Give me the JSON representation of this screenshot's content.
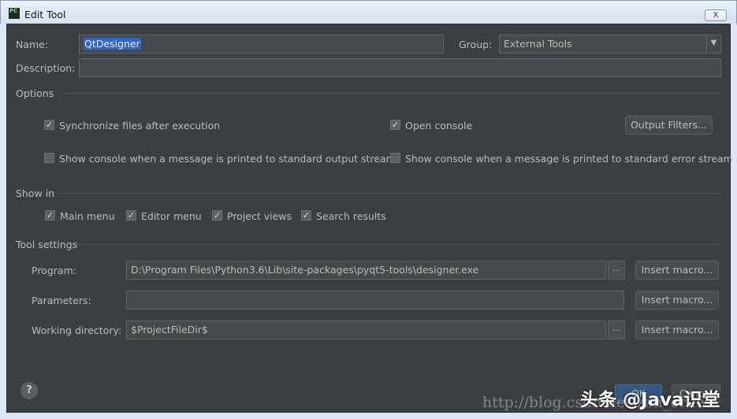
{
  "window": {
    "title": "Edit Tool",
    "icon_text": "PC",
    "close_label": "X"
  },
  "name": {
    "label": "Name:",
    "value": "QtDesigner"
  },
  "group": {
    "label": "Group:",
    "value": "External Tools"
  },
  "description": {
    "label": "Description:",
    "value": ""
  },
  "options": {
    "heading": "Options",
    "sync_files": "Synchronize files after execution",
    "open_console": "Open console",
    "output_filters": "Output Filters...",
    "show_console_stdout": "Show console when a message is printed to standard output stream",
    "show_console_stderr": "Show console when a message is printed to standard error stream"
  },
  "show_in": {
    "heading": "Show in",
    "items": [
      "Main menu",
      "Editor menu",
      "Project views",
      "Search results"
    ]
  },
  "tool_settings": {
    "heading": "Tool settings",
    "program": {
      "label": "Program:",
      "value": "D:\\Program Files\\Python3.6\\Lib\\site-packages\\pyqt5-tools\\designer.exe"
    },
    "parameters": {
      "label": "Parameters:",
      "value": ""
    },
    "working_dir": {
      "label": "Working directory:",
      "value": "$ProjectFileDir$"
    },
    "insert_macro": "Insert macro...",
    "browse": "..."
  },
  "footer": {
    "help": "?",
    "ok": "OK",
    "cancel": "Cancel"
  },
  "watermarks": {
    "blog": "http://blog.csdn.net/zzti_erlie",
    "brand": "头条 @Java识堂"
  }
}
